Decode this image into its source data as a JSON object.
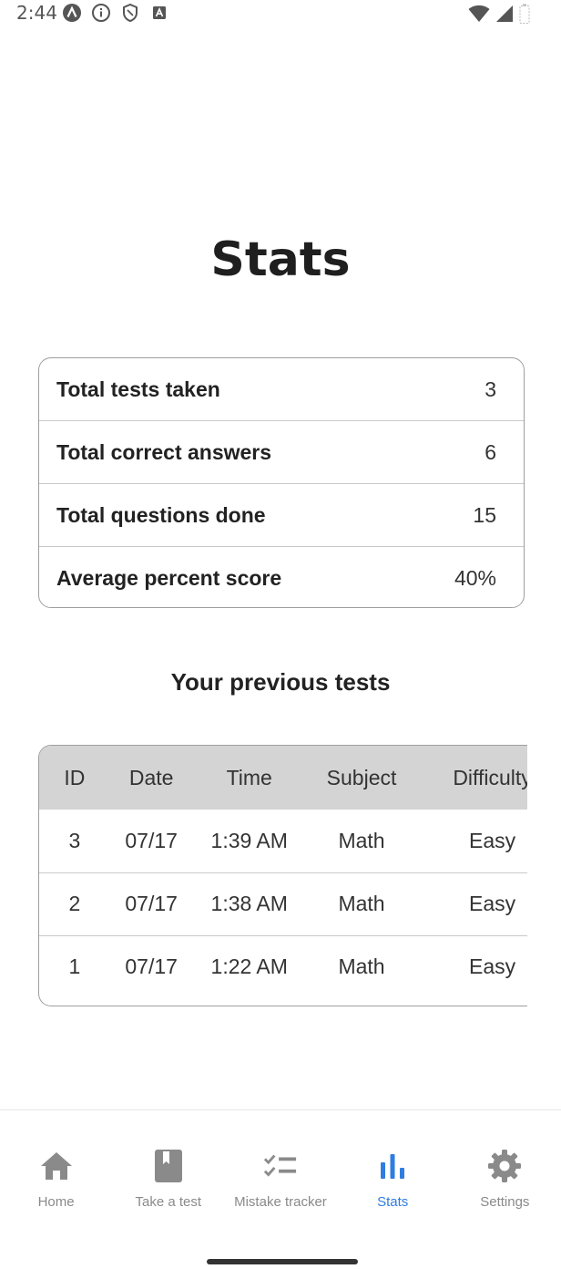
{
  "status_bar": {
    "time": "2:44",
    "icons": [
      "app-a-icon",
      "info-icon",
      "shield-icon",
      "font-a-icon",
      "wifi-icon",
      "cell-signal-icon",
      "battery-icon"
    ]
  },
  "page": {
    "title": "Stats"
  },
  "summary": {
    "rows": [
      {
        "label": "Total tests taken",
        "value": "3"
      },
      {
        "label": "Total correct answers",
        "value": "6"
      },
      {
        "label": "Total questions done",
        "value": "15"
      },
      {
        "label": "Average percent score",
        "value": "40%"
      }
    ]
  },
  "previous_tests": {
    "title": "Your previous tests",
    "columns": [
      "ID",
      "Date",
      "Time",
      "Subject",
      "Difficulty"
    ],
    "rows": [
      {
        "id": "3",
        "date": "07/17",
        "time": "1:39 AM",
        "subject": "Math",
        "difficulty": "Easy"
      },
      {
        "id": "2",
        "date": "07/17",
        "time": "1:38 AM",
        "subject": "Math",
        "difficulty": "Easy"
      },
      {
        "id": "1",
        "date": "07/17",
        "time": "1:22 AM",
        "subject": "Math",
        "difficulty": "Easy"
      }
    ]
  },
  "nav": {
    "items": [
      {
        "label": "Home",
        "icon": "home-icon"
      },
      {
        "label": "Take a test",
        "icon": "book-icon"
      },
      {
        "label": "Mistake tracker",
        "icon": "checklist-icon"
      },
      {
        "label": "Stats",
        "icon": "bar-chart-icon",
        "active": true
      },
      {
        "label": "Settings",
        "icon": "gear-icon"
      }
    ],
    "active_color": "#2f7de1",
    "inactive_color": "#8a8a8a"
  }
}
